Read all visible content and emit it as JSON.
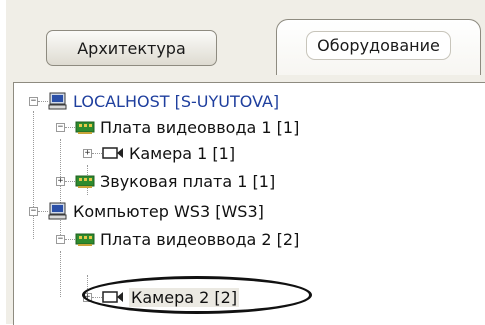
{
  "tabs": [
    {
      "label": "Архитектура",
      "active": false
    },
    {
      "label": "Оборудование",
      "active": true
    }
  ],
  "tree": {
    "computer_1": {
      "label": "LOCALHOST [S-UYUTOVA]",
      "expander": "−",
      "icon": "computer-icon",
      "children": {
        "video_card_1": {
          "label": "Плата видеоввода 1 [1]",
          "expander": "−",
          "icon": "video-card-icon",
          "children": {
            "camera_1": {
              "label": "Камера 1 [1]",
              "expander": "+",
              "icon": "camera-icon"
            }
          }
        },
        "sound_card_1": {
          "label": "Звуковая плата 1 [1]",
          "expander": "+",
          "icon": "sound-card-icon"
        }
      }
    },
    "computer_2": {
      "label": "Компьютер WS3 [WS3]",
      "expander": "−",
      "icon": "computer-icon",
      "children": {
        "video_card_2": {
          "label": "Плата видеоввода 2 [2]",
          "expander": "−",
          "icon": "video-card-icon",
          "children": {
            "camera_2": {
              "label": "Камера 2 [2]",
              "expander": "+",
              "icon": "camera-icon",
              "selected": true
            }
          }
        }
      }
    }
  },
  "colors": {
    "panel_bg": "#f0eee7",
    "host_label": "#1f3f9e",
    "card_icon": "#2e8b2e",
    "highlight_ring": "#111111"
  }
}
